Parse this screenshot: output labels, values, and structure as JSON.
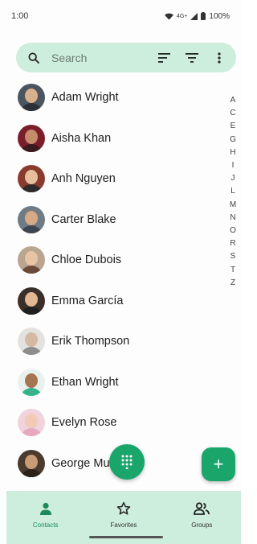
{
  "status_bar": {
    "time": "1:00",
    "network": "4G+",
    "battery": "100%"
  },
  "search": {
    "placeholder": "Search",
    "icons": [
      "search-icon",
      "sort-icon",
      "filter-icon",
      "more-vert-icon"
    ]
  },
  "contacts": [
    {
      "name": "Adam Wright",
      "avatar": {
        "bg": "#4a5560",
        "skin": "#d9b08c",
        "shirt": "#2c3038"
      }
    },
    {
      "name": "Aisha Khan",
      "avatar": {
        "bg": "#7a1e2a",
        "skin": "#c68b6b",
        "shirt": "#3a1a1f"
      }
    },
    {
      "name": "Anh Nguyen",
      "avatar": {
        "bg": "#8a3b2e",
        "skin": "#e6bf9c",
        "shirt": "#2b2b2b"
      }
    },
    {
      "name": "Carter Blake",
      "avatar": {
        "bg": "#6f7c86",
        "skin": "#d7a985",
        "shirt": "#3d4650"
      }
    },
    {
      "name": "Chloe Dubois",
      "avatar": {
        "bg": "#b9a590",
        "skin": "#e8c3a4",
        "shirt": "#6b4a3a"
      }
    },
    {
      "name": "Emma García",
      "avatar": {
        "bg": "#3a2f2a",
        "skin": "#e2b793",
        "shirt": "#1f1f1f"
      }
    },
    {
      "name": "Erik  Thompson",
      "avatar": {
        "bg": "#e4e2df",
        "skin": "#d6b9a3",
        "shirt": "#8d8d8d"
      }
    },
    {
      "name": "Ethan Wright",
      "avatar": {
        "bg": "#e9f1ee",
        "skin": "#a77452",
        "shirt": "#35b38a"
      }
    },
    {
      "name": "Evelyn Rose",
      "avatar": {
        "bg": "#f0d3dc",
        "skin": "#f1cbb6",
        "shirt": "#e6a9bd"
      }
    },
    {
      "name": "George Mu",
      "avatar": {
        "bg": "#4b3a2e",
        "skin": "#c99c74",
        "shirt": "#2a211b"
      }
    }
  ],
  "alphabet_index": [
    "A",
    "C",
    "E",
    "G",
    "H",
    "I",
    "J",
    "L",
    "M",
    "N",
    "O",
    "R",
    "S",
    "T",
    "Z"
  ],
  "fab": {
    "dialpad_icon": "dialpad-icon",
    "add_label": "+"
  },
  "bottom_nav": [
    {
      "label": "Contacts",
      "icon": "person-icon",
      "active": true
    },
    {
      "label": "Favorites",
      "icon": "star-outline-icon",
      "active": false
    },
    {
      "label": "Groups",
      "icon": "groups-icon",
      "active": false
    }
  ],
  "colors": {
    "accent": "#1aa56b",
    "surface_tint": "#cdeedd",
    "active_label": "#1a8a5a"
  }
}
